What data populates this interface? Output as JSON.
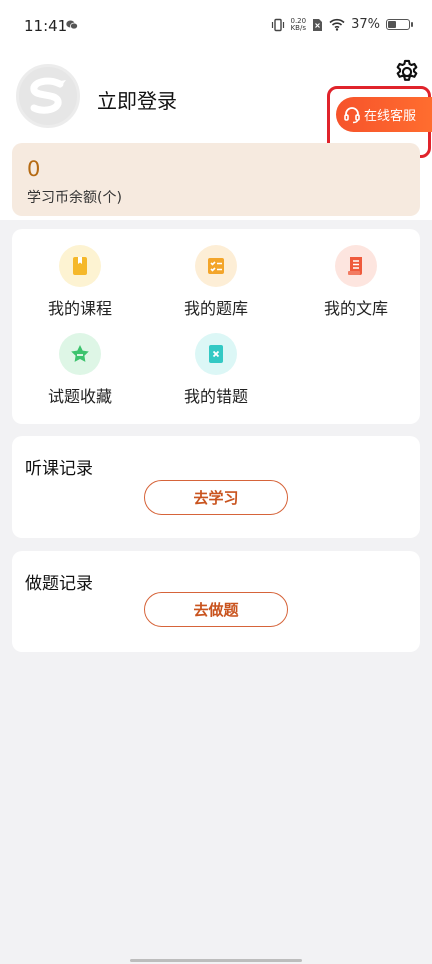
{
  "status_bar": {
    "time": "11:41",
    "net_speed_value": "0.20",
    "net_speed_unit": "KB/s",
    "battery": "37%",
    "battery_level": 0.37
  },
  "header": {
    "login_label": "立即登录",
    "service_label": "在线客服"
  },
  "balance": {
    "value": "0",
    "label": "学习币余额(个)"
  },
  "grid": {
    "items": [
      {
        "label": "我的课程",
        "icon": "course-book-icon",
        "color": "#f5b82a",
        "bg": "#fdf3d2"
      },
      {
        "label": "我的题库",
        "icon": "question-bank-icon",
        "color": "#f3a52a",
        "bg": "#fdeed6"
      },
      {
        "label": "我的文库",
        "icon": "document-library-icon",
        "color": "#ef5a3c",
        "bg": "#fde5df"
      },
      {
        "label": "试题收藏",
        "icon": "star-favorite-icon",
        "color": "#3cc36d",
        "bg": "#def6e6"
      },
      {
        "label": "我的错题",
        "icon": "wrong-question-icon",
        "color": "#33c9c4",
        "bg": "#dcf7f6"
      }
    ]
  },
  "listen_record": {
    "title": "听课记录",
    "button": "去学习"
  },
  "practice_record": {
    "title": "做题记录",
    "button": "去做题"
  },
  "colors": {
    "accent": "#f6532b",
    "balance_bg": "#f6eadf",
    "balance_text": "#b56a12"
  }
}
